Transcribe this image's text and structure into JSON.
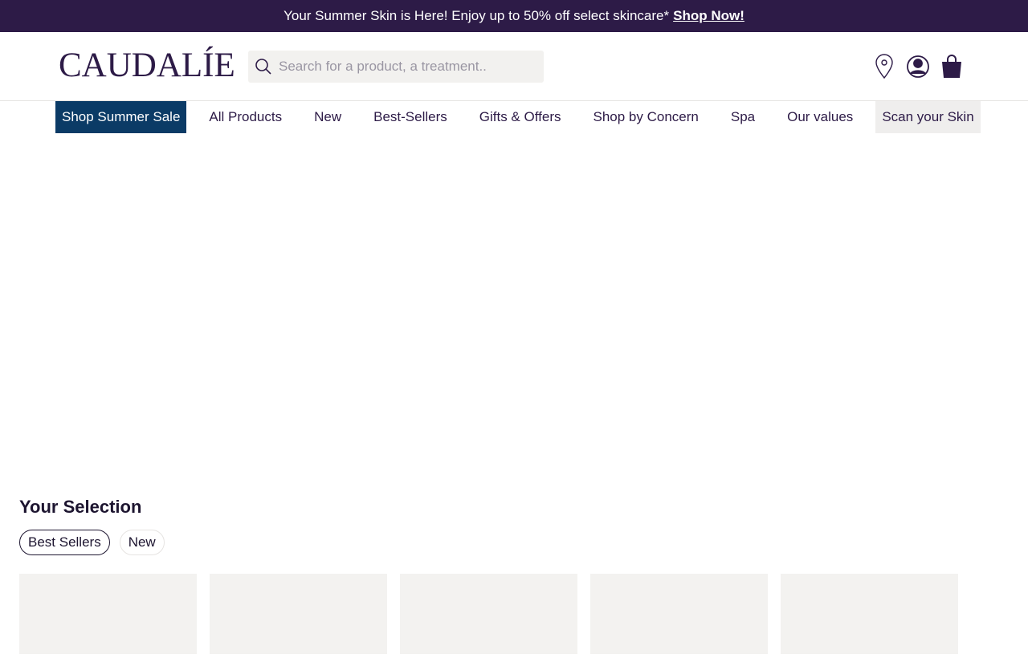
{
  "promo": {
    "text": "Your Summer Skin is Here! Enjoy up to 50% off select skincare*",
    "link": "Shop Now!"
  },
  "header": {
    "logo": "CAUDALÍE",
    "search_placeholder": "Search for a product, a treatment..",
    "icons": [
      "location-pin-icon",
      "account-icon",
      "shopping-bag-icon"
    ]
  },
  "nav": {
    "items": [
      {
        "label": "Shop Summer Sale"
      },
      {
        "label": "All Products"
      },
      {
        "label": "New"
      },
      {
        "label": "Best-Sellers"
      },
      {
        "label": "Gifts & Offers"
      },
      {
        "label": "Shop by Concern"
      },
      {
        "label": "Spa"
      },
      {
        "label": "Our values"
      },
      {
        "label": "Scan your Skin"
      }
    ]
  },
  "selection": {
    "title": "Your Selection",
    "tabs": [
      {
        "label": "Best Sellers",
        "active": true
      },
      {
        "label": "New",
        "active": false
      }
    ]
  },
  "colors": {
    "brand_dark": "#2d1b47",
    "sale_blue": "#0b3b66",
    "card_bg": "#f3f2f0"
  }
}
